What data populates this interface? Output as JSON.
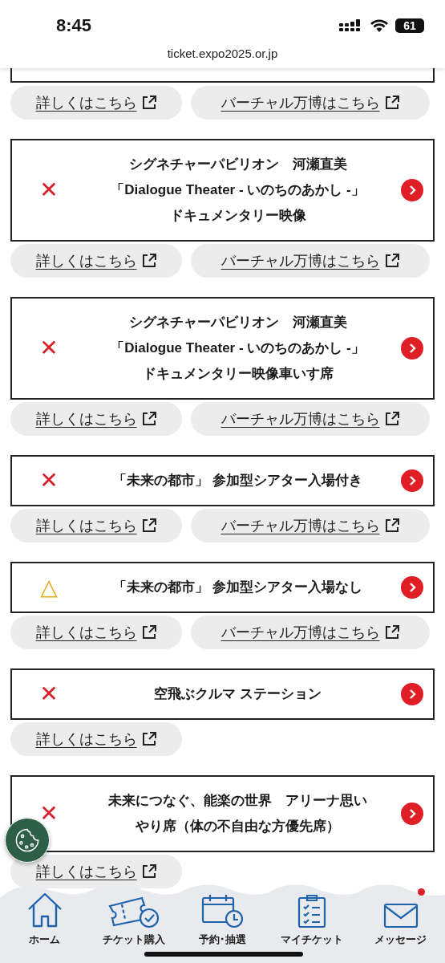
{
  "status_bar": {
    "time": "8:45",
    "battery": "61"
  },
  "address_bar": {
    "url": "ticket.expo2025.or.jp"
  },
  "entries": [
    {
      "kind": "cut-off",
      "links": [
        {
          "label": "詳しくはこちら"
        },
        {
          "label": "バーチャル万博はこちら"
        }
      ]
    },
    {
      "kind": "card",
      "mark": "✕",
      "color": "#d7202a",
      "title_lines": [
        "シグネチャーパビリオン　河瀬直美",
        "「Dialogue Theater - いのちのあかし -」",
        "ドキュメンタリー映像"
      ],
      "links": [
        {
          "label": "詳しくはこちら"
        },
        {
          "label": "バーチャル万博はこちら"
        }
      ]
    },
    {
      "kind": "card",
      "mark": "✕",
      "color": "#d7202a",
      "title_lines": [
        "シグネチャーパビリオン　河瀬直美",
        "「Dialogue Theater - いのちのあかし -」",
        "ドキュメンタリー映像車いす席"
      ],
      "links": [
        {
          "label": "詳しくはこちら"
        },
        {
          "label": "バーチャル万博はこちら"
        }
      ]
    },
    {
      "kind": "card",
      "mark": "✕",
      "color": "#d7202a",
      "title_lines": [
        "「未来の都市」 参加型シアター入場付き"
      ],
      "links": [
        {
          "label": "詳しくはこちら"
        },
        {
          "label": "バーチャル万博はこちら"
        }
      ]
    },
    {
      "kind": "card",
      "mark": "△",
      "color": "#e5a91a",
      "title_lines": [
        "「未来の都市」 参加型シアター入場なし"
      ],
      "links": [
        {
          "label": "詳しくはこちら"
        },
        {
          "label": "バーチャル万博はこちら"
        }
      ]
    },
    {
      "kind": "card",
      "mark": "✕",
      "color": "#d7202a",
      "title_lines": [
        "空飛ぶクルマ ステーション"
      ],
      "links": [
        {
          "label": "詳しくはこちら"
        }
      ]
    },
    {
      "kind": "card",
      "mark": "✕",
      "color": "#d7202a",
      "title_lines": [
        "未来につなぐ、能楽の世界　アリーナ思い",
        "やり席（体の不自由な方優先席）"
      ],
      "links": [
        {
          "label": "詳しくはこちら"
        }
      ]
    }
  ],
  "bottom_nav": [
    {
      "label": "ホーム",
      "badge": false
    },
    {
      "label": "チケット購入",
      "badge": false
    },
    {
      "label": "予約･抽選",
      "badge": false
    },
    {
      "label": "マイチケット",
      "badge": false
    },
    {
      "label": "メッセージ",
      "badge": true
    }
  ]
}
